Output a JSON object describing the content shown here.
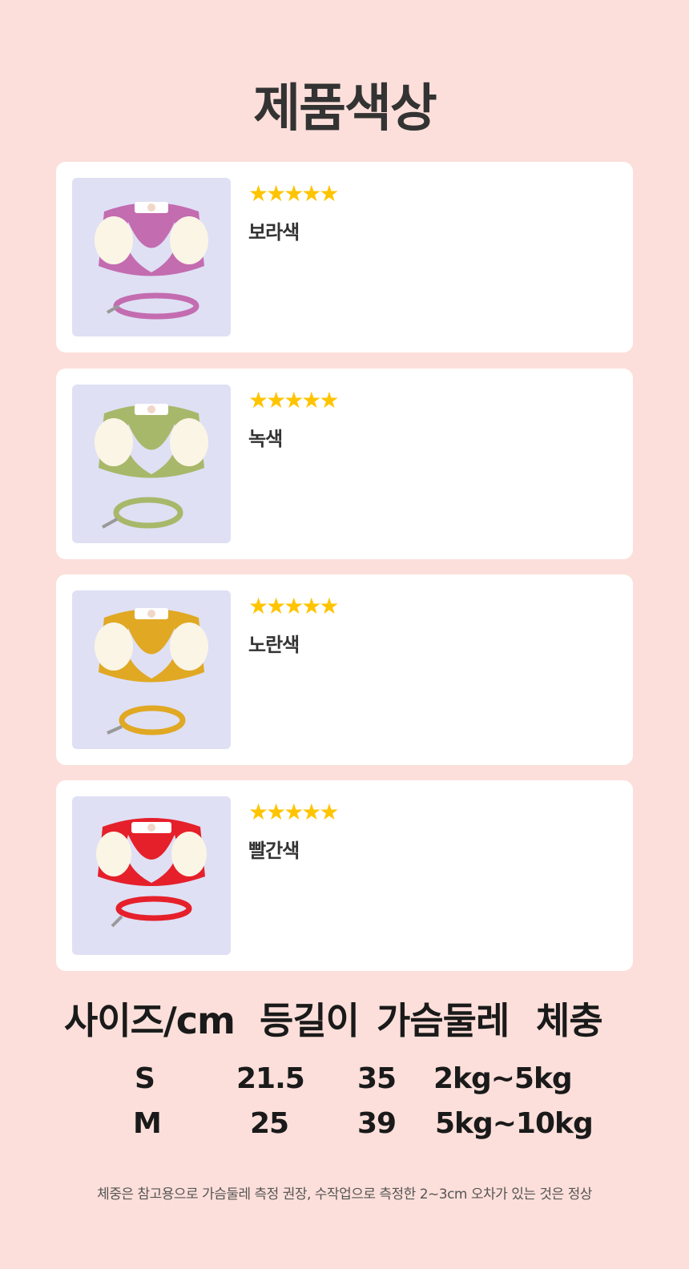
{
  "title": "제품색상",
  "colors": [
    {
      "rating": "★★★★★",
      "stars": 5,
      "name": "보라색",
      "image": "purple-harness-with-leash",
      "hex": "#c46cb0"
    },
    {
      "rating": "★★★★★",
      "stars": 5,
      "name": "녹색",
      "image": "green-harness-with-leash",
      "hex": "#a8b86a"
    },
    {
      "rating": "★★★★★",
      "stars": 5,
      "name": "노란색",
      "image": "yellow-harness-with-leash",
      "hex": "#e0a823"
    },
    {
      "rating": "★★★★★",
      "stars": 5,
      "name": "빨간색",
      "image": "red-harness-with-leash",
      "hex": "#e5202a"
    }
  ],
  "size_table": {
    "headers": [
      "사이즈/cm",
      "등길이",
      "가슴둘레",
      "체충"
    ],
    "rows": [
      {
        "size": "S",
        "back_length": "21.5",
        "chest": "35",
        "weight": "2kg~5kg"
      },
      {
        "size": "M",
        "back_length": "25",
        "chest": "39",
        "weight": "5kg~10kg"
      }
    ]
  },
  "footnote": "체중은 참고용으로 가슴둘레 측정 권장, 수작업으로 측정한  2~3cm 오차가 있는 것은 정상",
  "theme": {
    "background": "#fcdfda",
    "star_color": "#ffc400"
  }
}
